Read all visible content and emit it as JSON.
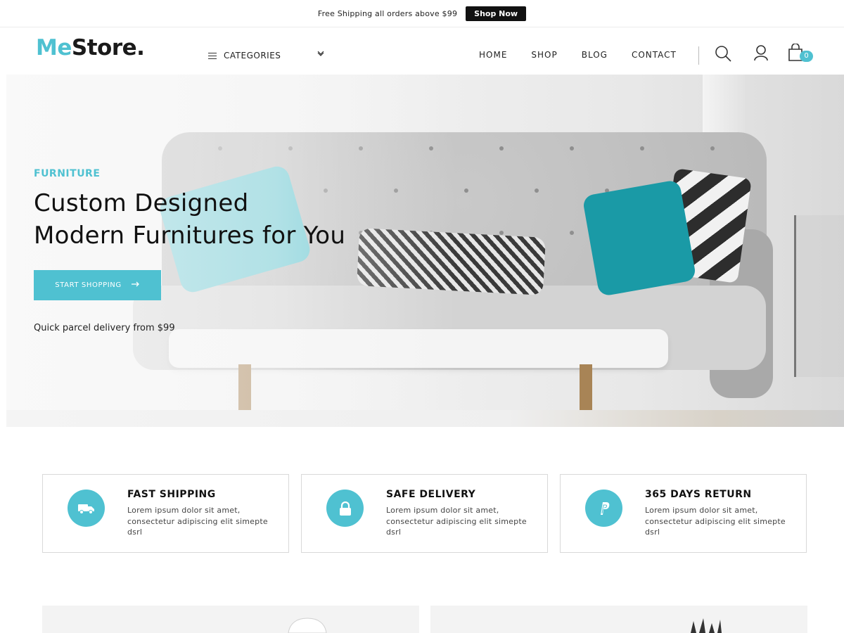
{
  "topbar": {
    "message": "Free Shipping all orders above $99",
    "cta": "Shop Now"
  },
  "header": {
    "logo_part1": "Me",
    "logo_part2": "Store.",
    "categories_label": "CATEGORIES",
    "nav": [
      "HOME",
      "SHOP",
      "BLOG",
      "CONTACT"
    ],
    "cart_count": "0"
  },
  "hero": {
    "kicker": "FURNITURE",
    "title_line1": "Custom Designed",
    "title_line2": "Modern Furnitures for You",
    "button": "START SHOPPING",
    "subtitle": "Quick parcel delivery from $99"
  },
  "features": [
    {
      "icon": "truck-icon",
      "title": "FAST SHIPPING",
      "text": "Lorem ipsum dolor sit amet, consectetur adipiscing elit simepte dsrl"
    },
    {
      "icon": "lock-icon",
      "title": "SAFE DELIVERY",
      "text": "Lorem ipsum dolor sit amet, consectetur adipiscing elit simepte dsrl"
    },
    {
      "icon": "paypal-icon",
      "title": "365 DAYS RETURN",
      "text": "Lorem ipsum dolor sit amet, consectetur adipiscing elit simepte dsrl"
    }
  ],
  "colors": {
    "accent": "#4fc1d1",
    "text": "#111111",
    "button_dark": "#111111"
  }
}
